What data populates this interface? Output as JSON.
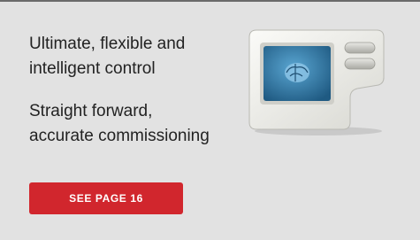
{
  "promo": {
    "line1a": "Ultimate, flexible and",
    "line1b": "intelligent control",
    "line2a": "Straight forward,",
    "line2b": "accurate commissioning",
    "cta_label": "SEE PAGE 16"
  },
  "colors": {
    "background": "#e2e2e2",
    "cta": "#d1262d",
    "text": "#222222",
    "screen": "#2f6f98"
  },
  "icons": {
    "device": "thermostat-controller-icon",
    "screen_graphic": "brain-icon"
  }
}
